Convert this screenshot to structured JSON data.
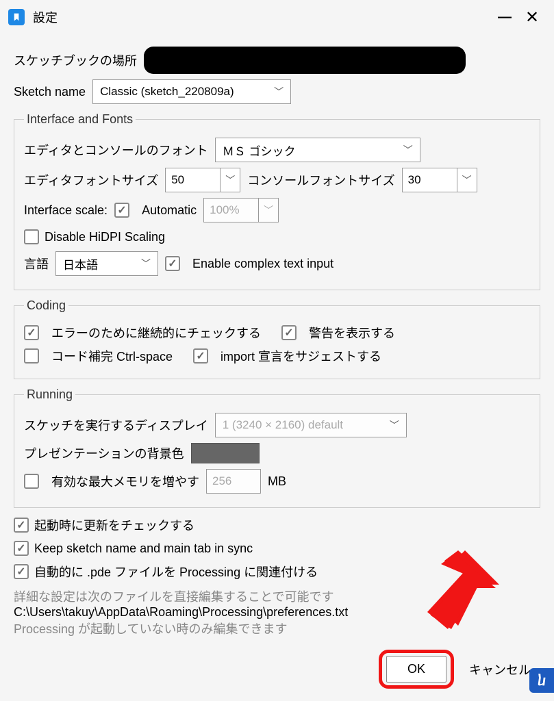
{
  "titlebar": {
    "title": "設定"
  },
  "sketchbook_location_label": "スケッチブックの場所",
  "sketch_name": {
    "label": "Sketch name",
    "value": "Classic (sketch_220809a)"
  },
  "interface_fonts": {
    "legend": "Interface and Fonts",
    "editor_console_font_label": "エディタとコンソールのフォント",
    "editor_console_font_value": "ＭＳ ゴシック",
    "editor_font_size_label": "エディタフォントサイズ",
    "editor_font_size_value": "50",
    "console_font_size_label": "コンソールフォントサイズ",
    "console_font_size_value": "30",
    "interface_scale_label": "Interface scale:",
    "automatic_label": "Automatic",
    "automatic_checked": true,
    "scale_value": "100%",
    "disable_hidpi_label": "Disable HiDPI Scaling",
    "disable_hidpi_checked": false,
    "language_label": "言語",
    "language_value": "日本語",
    "complex_text_label": "Enable complex text input",
    "complex_text_checked": true
  },
  "coding": {
    "legend": "Coding",
    "continuous_check_label": "エラーのために継続的にチェックする",
    "continuous_check_checked": true,
    "show_warnings_label": "警告を表示する",
    "show_warnings_checked": true,
    "code_completion_label": "コード補完 Ctrl-space",
    "code_completion_checked": false,
    "import_suggest_label": "import 宣言をサジェストする",
    "import_suggest_checked": true
  },
  "running": {
    "legend": "Running",
    "display_label": "スケッチを実行するディスプレイ",
    "display_value": "1 (3240 × 2160) default",
    "presentation_bg_label": "プレゼンテーションの背景色",
    "max_memory_label": "有効な最大メモリを増やす",
    "max_memory_checked": false,
    "max_memory_value": "256",
    "max_memory_unit": "MB"
  },
  "misc": {
    "check_updates_label": "起動時に更新をチェックする",
    "check_updates_checked": true,
    "keep_sync_label": "Keep sketch name and main tab in sync",
    "keep_sync_checked": true,
    "associate_pde_label": "自動的に .pde ファイルを Processing に関連付ける",
    "associate_pde_checked": true
  },
  "footer": {
    "more_prefs_note": "詳細な設定は次のファイルを直接編集することで可能です",
    "prefs_path": "C:\\Users\\takuy\\AppData\\Roaming\\Processing\\preferences.txt",
    "edit_note": "Processing が起動していない時のみ編集できます",
    "ok_label": "OK",
    "cancel_label": "キャンセル"
  }
}
